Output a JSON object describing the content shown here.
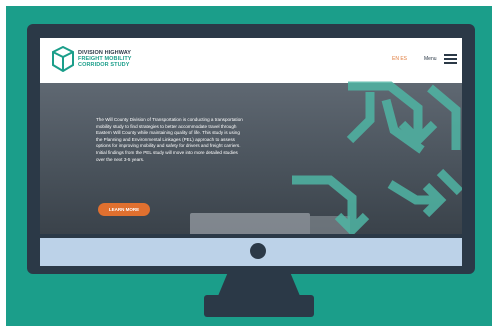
{
  "site": {
    "logo_line1": "DIVISION HIGHWAY",
    "logo_line2": "FREIGHT MOBILITY",
    "logo_line3": "CORRIDOR STUDY",
    "lang_label": "EN  ES",
    "menu_label": "Menu"
  },
  "hero": {
    "paragraph": "The Will County Division of Transportation is conducting a transportation mobility study to find strategies to better accommodate travel through Eastern Will County while maintaining quality of life. This study is using the Planning and Environmental Linkages (PEL) approach to assess options for improving mobility and safety for drivers and freight carriers. Initial findings from the PEL study will move into more detailed studies over the next 3-5 years.",
    "button_label": "LEARN MORE"
  },
  "colors": {
    "teal": "#1b9e8a",
    "monitor": "#2b3947",
    "accent_orange": "#e0702f",
    "chin_blue": "#bcd2e8"
  },
  "icons": [
    "logo-cube-icon",
    "hamburger-menu-icon",
    "arrow-graphic-icon",
    "power-button-icon"
  ]
}
